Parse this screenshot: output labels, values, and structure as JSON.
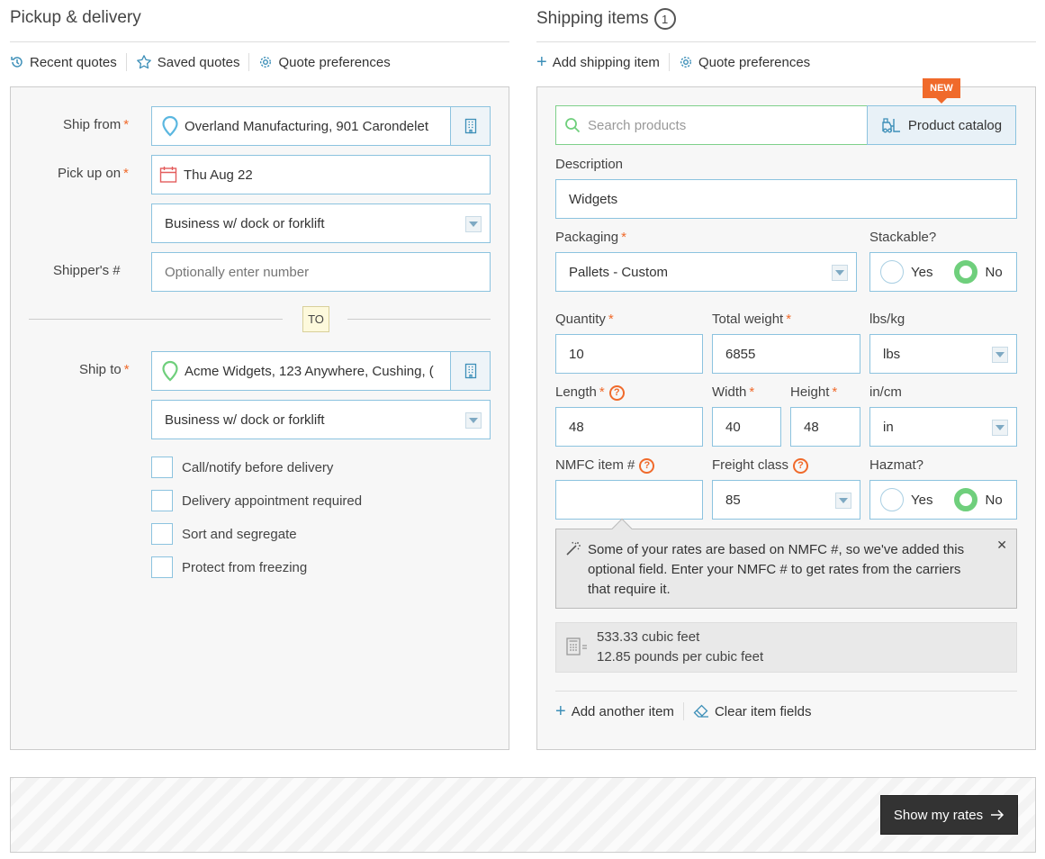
{
  "pickup": {
    "title": "Pickup & delivery",
    "toolbar": {
      "recent": "Recent quotes",
      "saved": "Saved quotes",
      "prefs": "Quote preferences"
    },
    "ship_from_label": "Ship from",
    "ship_from_value": "Overland Manufacturing, 901 Carondelet",
    "pick_up_label": "Pick up on",
    "pick_up_value": "Thu Aug 22",
    "pickup_location_type": "Business w/ dock or forklift",
    "shipper_label": "Shipper's #",
    "shipper_placeholder": "Optionally enter number",
    "to_badge": "TO",
    "ship_to_label": "Ship to",
    "ship_to_value": "Acme Widgets, 123 Anywhere, Cushing, (",
    "delivery_location_type": "Business w/ dock or forklift",
    "options": [
      "Call/notify before delivery",
      "Delivery appointment required",
      "Sort and segregate",
      "Protect from freezing"
    ]
  },
  "shipping": {
    "title": "Shipping items",
    "count": "1",
    "toolbar": {
      "add": "Add shipping item",
      "prefs": "Quote preferences"
    },
    "new_badge": "NEW",
    "search_placeholder": "Search products",
    "catalog_label": "Product catalog",
    "description_label": "Description",
    "description_value": "Widgets",
    "packaging_label": "Packaging",
    "packaging_value": "Pallets - Custom",
    "stackable_label": "Stackable?",
    "yes": "Yes",
    "no": "No",
    "quantity_label": "Quantity",
    "quantity_value": "10",
    "weight_label": "Total weight",
    "weight_value": "6855",
    "weight_unit_label": "lbs/kg",
    "weight_unit_value": "lbs",
    "length_label": "Length",
    "length_value": "48",
    "width_label": "Width",
    "width_value": "40",
    "height_label": "Height",
    "height_value": "48",
    "dim_unit_label": "in/cm",
    "dim_unit_value": "in",
    "nmfc_label": "NMFC item #",
    "freight_label": "Freight class",
    "freight_value": "85",
    "hazmat_label": "Hazmat?",
    "tooltip": "Some of your rates are based on NMFC #, so we've added this optional field. Enter your NMFC # to get rates from the carriers that require it.",
    "calc_volume": "533.33 cubic feet",
    "calc_density": "12.85 pounds per cubic feet",
    "add_another": "Add another item",
    "clear_fields": "Clear item fields"
  },
  "footer": {
    "show_rates": "Show my rates"
  },
  "colors": {
    "accent": "#f06a2b",
    "field_border": "#8cc3df",
    "radio_on": "#6fcf7c",
    "search_border": "#7ed08a",
    "dark_button": "#333333"
  }
}
